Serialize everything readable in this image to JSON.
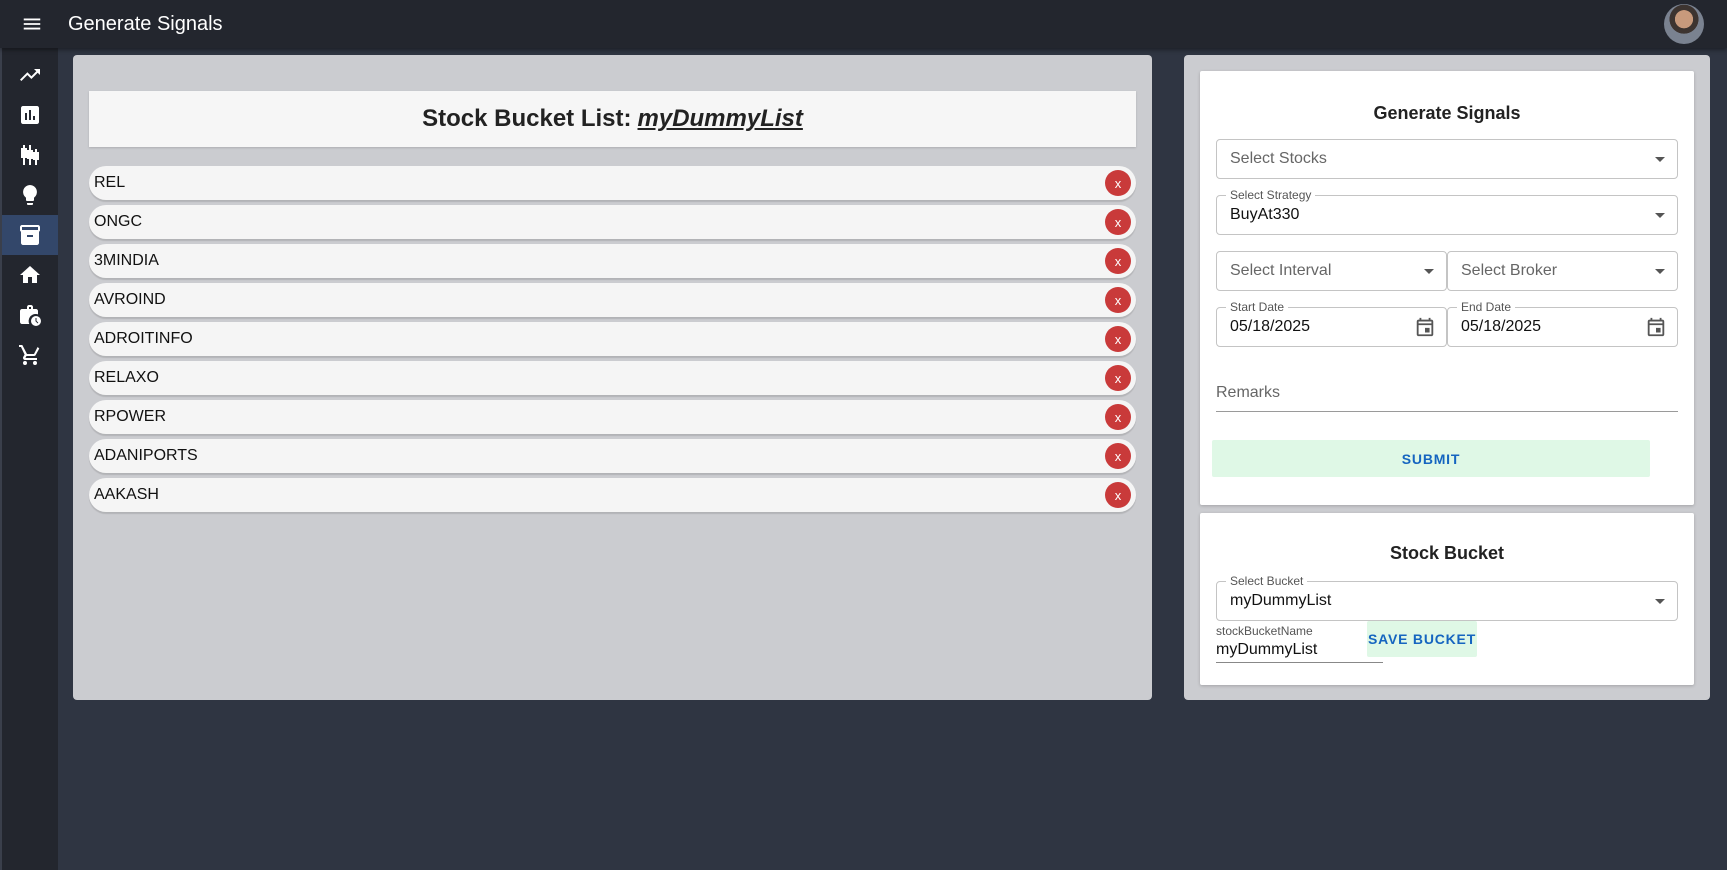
{
  "appbar": {
    "title": "Generate Signals"
  },
  "sidebar": {
    "items": [
      {
        "icon": "trending-up-icon"
      },
      {
        "icon": "analytics-icon"
      },
      {
        "icon": "candlestick-icon"
      },
      {
        "icon": "lightbulb-icon"
      },
      {
        "icon": "archive-icon",
        "active": true
      },
      {
        "icon": "home-icon"
      },
      {
        "icon": "work-history-icon"
      },
      {
        "icon": "cart-icon"
      }
    ]
  },
  "bucket_list": {
    "title_prefix": "Stock Bucket List:",
    "bucket_name": "myDummyList",
    "remove_label": "x",
    "stocks": [
      "REL",
      "ONGC",
      "3MINDIA",
      "AVROIND",
      "ADROITINFO",
      "RELAXO",
      "RPOWER",
      "ADANIPORTS",
      "AAKASH"
    ]
  },
  "generate_signals": {
    "title": "Generate Signals",
    "stocks_placeholder": "Select Stocks",
    "strategy_label": "Select Strategy",
    "strategy_value": "BuyAt330",
    "interval_placeholder": "Select Interval",
    "broker_placeholder": "Select Broker",
    "start_date_label": "Start Date",
    "start_date_value": "05/18/2025",
    "end_date_label": "End Date",
    "end_date_value": "05/18/2025",
    "remarks_placeholder": "Remarks",
    "submit_label": "SUBMIT"
  },
  "stock_bucket": {
    "title": "Stock Bucket",
    "select_label": "Select Bucket",
    "select_value": "myDummyList",
    "name_label": "stockBucketName",
    "name_value": "myDummyList",
    "save_label": "SAVE BUCKET"
  },
  "colors": {
    "appbar_bg": "#23262e",
    "page_bg": "#2f3542",
    "panel_bg": "#cbccd0",
    "remove_button": "#c93a3a",
    "button_bg": "#dff8e6",
    "button_text": "#1565c0"
  }
}
